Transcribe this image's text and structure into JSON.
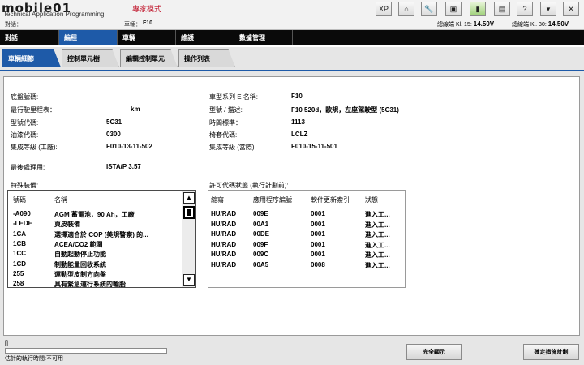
{
  "header": {
    "logo": "mobile01",
    "app_title": "Technical Application Programming",
    "expert_mode": "專家模式",
    "dialog_label": "對話：",
    "vehicle_label": "車輛：",
    "vehicle_value": "F10",
    "kl15_label": "總線端 Kl. 15:",
    "kl15_value": "14.50V",
    "kl30_label": "總線端 Kl. 30:",
    "kl30_value": "14.50V"
  },
  "toolbar": [
    {
      "name": "xp-button",
      "glyph": "XP"
    },
    {
      "name": "home-icon",
      "glyph": "⌂"
    },
    {
      "name": "wrench-icon",
      "glyph": "🔧"
    },
    {
      "name": "connection-icon",
      "glyph": "▣"
    },
    {
      "name": "battery-icon",
      "glyph": "▮"
    },
    {
      "name": "print-icon",
      "glyph": "▤"
    },
    {
      "name": "help-icon",
      "glyph": "?"
    },
    {
      "name": "minimize-icon",
      "glyph": "▾"
    },
    {
      "name": "close-icon",
      "glyph": "✕"
    }
  ],
  "main_nav": [
    "對話",
    "編程",
    "車輛",
    "維護",
    "數據管理"
  ],
  "main_nav_active": 1,
  "sub_tabs": [
    "車輛細節",
    "控制單元樹",
    "編輯控制單元",
    "操作列表"
  ],
  "sub_tabs_active": 0,
  "details_left": [
    {
      "label": "底盤號碼:",
      "value": ""
    },
    {
      "label": "最行駛里程表：",
      "value": "km"
    },
    {
      "label": "型號代碼:",
      "value": "5C31"
    },
    {
      "label": "油漆代碼:",
      "value": "0300"
    },
    {
      "label": "集成等級 (工廠):",
      "value": "F010-13-11-502"
    }
  ],
  "details_right": [
    {
      "label": "車型系列 E 名稱:",
      "value": "F10"
    },
    {
      "label": "型號 / 描述:",
      "value": "F10 520d，歐規，左座駕駛型 (5C31)"
    },
    {
      "label": "時間標準：",
      "value": "1113"
    },
    {
      "label": "椅套代碼:",
      "value": "LCLZ"
    },
    {
      "label": "集成等級 (當際):",
      "value": "F010-15-11-501"
    }
  ],
  "last_processing": {
    "label": "最後處理用:",
    "value": "ISTA/P 3.57"
  },
  "special_equipment": {
    "title": "特殊裝備:",
    "headers": [
      "號碼",
      "名稱"
    ],
    "rows": [
      {
        "code": "-A090",
        "name": "AGM 蓄電池，90 Ah，工廠"
      },
      {
        "code": "-LEDE",
        "name": "頁皮裝備"
      },
      {
        "code": "1CA",
        "name": "選擇適合於 COP (美規警察) 的..."
      },
      {
        "code": "1CB",
        "name": "ACEA/CO2 範圍"
      },
      {
        "code": "1CC",
        "name": "自動起動停止功能"
      },
      {
        "code": "1CD",
        "name": "制動能量回收系統"
      },
      {
        "code": "255",
        "name": "運動型皮制方向盤"
      },
      {
        "code": "258",
        "name": "具有緊急運行系統的輪胎"
      }
    ]
  },
  "license_codes": {
    "title": "許可代碼狀態 (執行計劃前):",
    "headers": [
      "縮寫",
      "應用程序編號",
      "軟件更新索引",
      "狀態"
    ],
    "rows": [
      {
        "abbr": "HU/RAD",
        "app": "009E",
        "index": "0001",
        "status": "進入工..."
      },
      {
        "abbr": "HU/RAD",
        "app": "00A1",
        "index": "0001",
        "status": "進入工..."
      },
      {
        "abbr": "HU/RAD",
        "app": "00DE",
        "index": "0001",
        "status": "進入工..."
      },
      {
        "abbr": "HU/RAD",
        "app": "009F",
        "index": "0001",
        "status": "進入工..."
      },
      {
        "abbr": "HU/RAD",
        "app": "009C",
        "index": "0001",
        "status": "進入工..."
      },
      {
        "abbr": "HU/RAD",
        "app": "00A5",
        "index": "0008",
        "status": "進入工..."
      }
    ]
  },
  "footer": {
    "mark": "[]",
    "eta": "估計的執行時間:不可用",
    "progress": 0,
    "btn_full_show": "完全顯示",
    "btn_confirm_plan": "確定措施計劃"
  }
}
